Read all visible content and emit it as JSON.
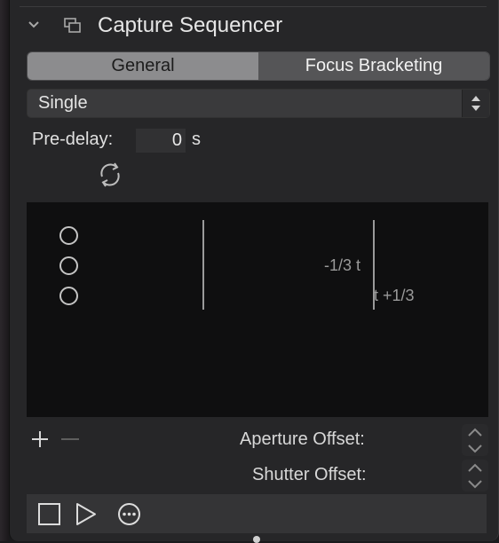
{
  "header": {
    "title": "Capture Sequencer"
  },
  "tabs": [
    {
      "label": "General",
      "selected": false
    },
    {
      "label": "Focus Bracketing",
      "selected": true
    }
  ],
  "mode_select": {
    "value": "Single"
  },
  "predelay": {
    "label": "Pre-delay:",
    "value": "0",
    "unit": "s"
  },
  "sequence": {
    "steps": 3,
    "label_a": "-1/3 t",
    "label_b": "t +1/3"
  },
  "offsets": {
    "aperture_label": "Aperture Offset:",
    "shutter_label": "Shutter Offset:"
  },
  "icons": {
    "collapse": "chevron-down-icon",
    "window": "detach-window-icon",
    "refresh": "refresh-icon",
    "add": "plus-icon",
    "remove": "minus-icon",
    "stop": "stop-icon",
    "play": "play-icon",
    "more": "more-icon"
  },
  "colors": {
    "panel_bg": "#262628",
    "list_bg": "#0f0f10",
    "tab_selected_bg": "#555557",
    "tab_unselected_bg": "#8c8c8e"
  }
}
